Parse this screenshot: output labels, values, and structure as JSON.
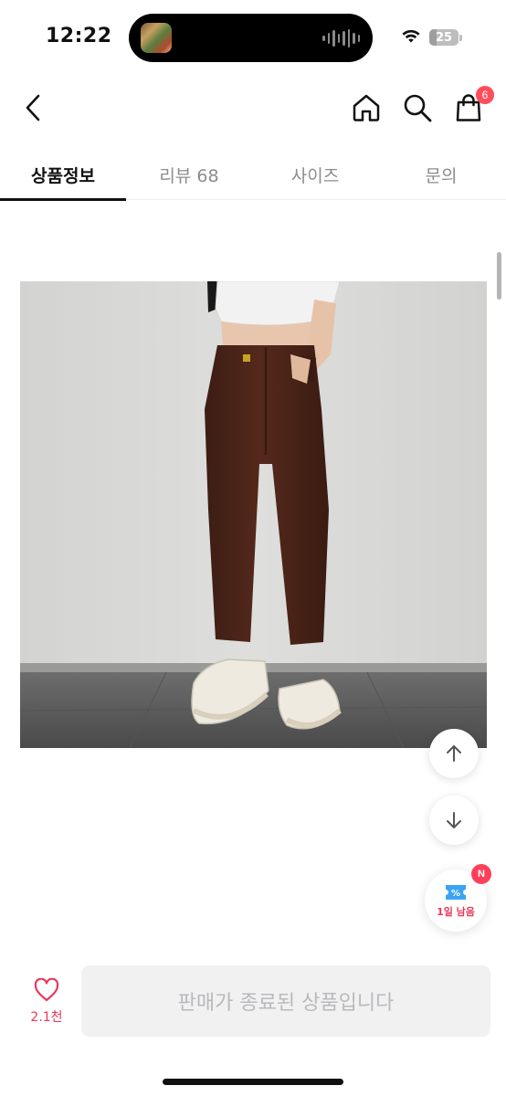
{
  "status_bar": {
    "time": "12:22",
    "battery": "25",
    "battery_level": 0.25,
    "icons": [
      "wifi-icon",
      "battery-icon",
      "audio-wave-icon"
    ]
  },
  "header": {
    "icons": [
      "back-arrow-icon",
      "home-icon",
      "search-icon",
      "shopping-bag-icon"
    ],
    "cart_count": "6"
  },
  "tabs": [
    {
      "label": "상품정보",
      "active": true
    },
    {
      "label": "리뷰 68",
      "active": false
    },
    {
      "label": "사이즈",
      "active": false
    },
    {
      "label": "문의",
      "active": false
    }
  ],
  "floating": {
    "icons": [
      "arrow-up-icon",
      "arrow-down-icon",
      "coupon-icon"
    ],
    "coupon_label": "1일 남음",
    "coupon_badge": "N"
  },
  "bottom_bar": {
    "like_count": "2.1천",
    "cta_label": "판매가 종료된 상품입니다"
  },
  "colors": {
    "accent": "#e8385a",
    "badge": "#ff4d5b",
    "pants": "#4a2418",
    "wall": "#d8d8d6",
    "floor": "#5c5c5c"
  }
}
